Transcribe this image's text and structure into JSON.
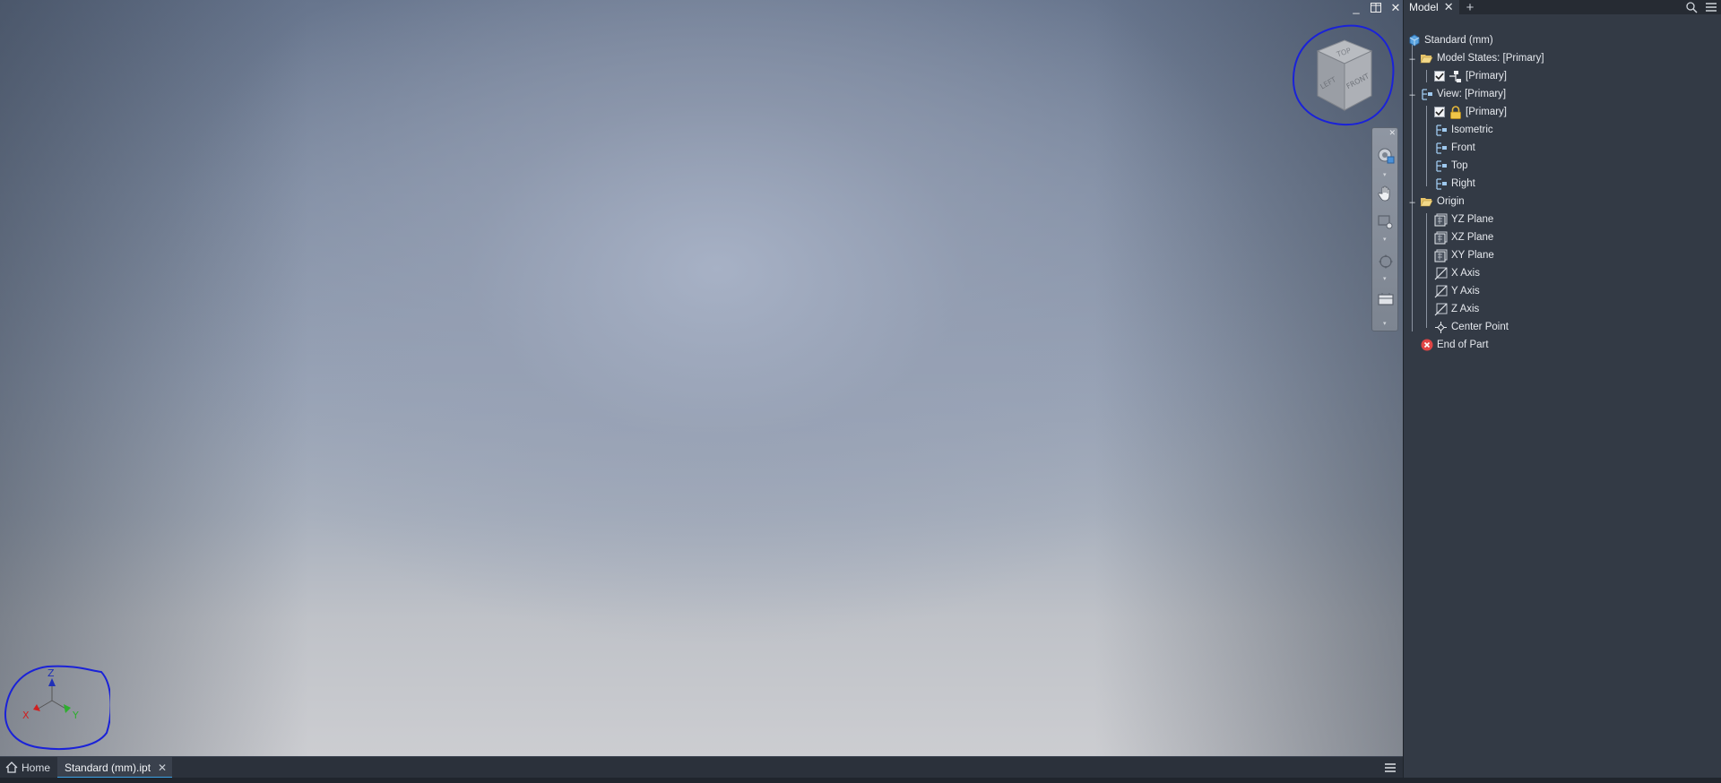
{
  "window": {
    "minimize_glyph": "_",
    "restore_glyph": "restore-icon",
    "close_glyph": "✕"
  },
  "viewcube": {
    "faces": {
      "top": "TOP",
      "left": "LEFT",
      "front": "FRONT"
    }
  },
  "triad": {
    "x": "X",
    "y": "Y",
    "z": "Z",
    "colors": {
      "x": "#d02020",
      "y": "#2fae2f",
      "z": "#1f2fb8"
    }
  },
  "panel": {
    "tab_label": "Model",
    "add_tab": "+",
    "tree": {
      "root": "Standard (mm)",
      "model_states": "Model States: [Primary]",
      "model_state_primary": "[Primary]",
      "view": "View: [Primary]",
      "view_primary": "[Primary]",
      "views": [
        "Isometric",
        "Front",
        "Top",
        "Right"
      ],
      "origin": "Origin",
      "origin_items": [
        "YZ Plane",
        "XZ Plane",
        "XY Plane",
        "X Axis",
        "Y Axis",
        "Z Axis",
        "Center Point"
      ],
      "end_of_part": "End of Part"
    }
  },
  "tabbar": {
    "home": "Home",
    "document": "Standard (mm).ipt",
    "close": "✕"
  },
  "colors": {
    "annotation_circle": "#1a22d8",
    "active_tab_underline": "#3ba2e6",
    "error": "#e04545"
  }
}
